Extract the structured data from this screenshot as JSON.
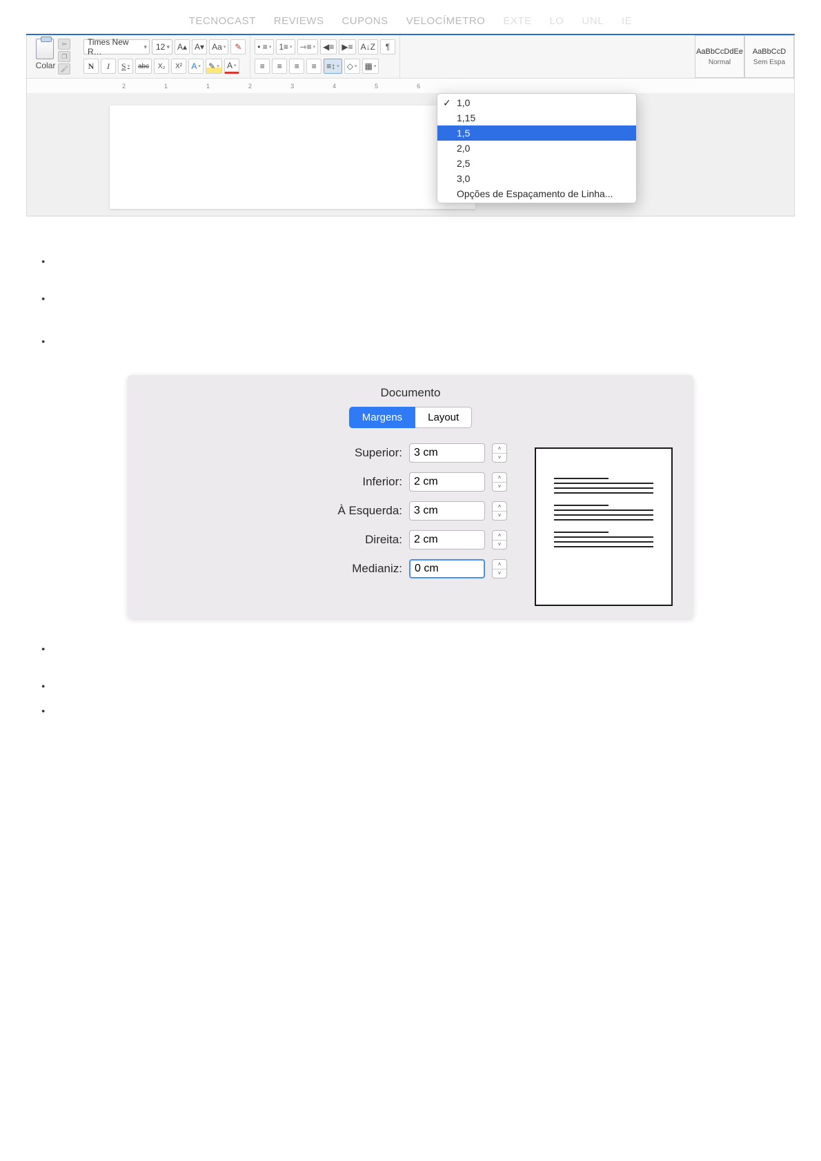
{
  "nav": {
    "items": [
      "TECNOCAST",
      "REVIEWS",
      "CUPONS",
      "VELOCÍMETRO",
      "EXTE",
      "LO",
      "UNL",
      "IE"
    ]
  },
  "ribbon": {
    "paste_label": "Colar",
    "font_name": "Times New R…",
    "font_size": "12",
    "bold": "N",
    "italic": "I",
    "underline": "S",
    "strike": "abc",
    "sub": "X₂",
    "sup": "X²",
    "grow": "A▴",
    "shrink": "A▾",
    "caps": "Aa",
    "clear": "✎",
    "texteffect": "A",
    "highlight": "✎",
    "fontcolor": "A",
    "left": "≡",
    "center": "≡",
    "right": "≡",
    "just": "≡",
    "bullets": "• ≡",
    "numbers": "1≡",
    "multilevel": "⇾≡",
    "outdent": "◀≡",
    "indent": "▶≡",
    "sort": "A↓Z",
    "pilcrow": "¶",
    "linespace": "≡↕",
    "fill": "◇",
    "border": "▦"
  },
  "styles": {
    "s1_prev": "AaBbCcDdEe",
    "s1_name": "Normal",
    "s2_prev": "AaBbCcD",
    "s2_name": "Sem Espa"
  },
  "linespacing": {
    "i0": "1,0",
    "i1": "1,15",
    "i2": "1,5",
    "i3": "2,0",
    "i4": "2,5",
    "i5": "3,0",
    "opts": "Opções de Espaçamento de Linha..."
  },
  "ruler": {
    "m0": "2",
    "m1": "1",
    "m2": "1",
    "m3": "2",
    "m4": "3",
    "m5": "4",
    "m6": "5",
    "m7": "6"
  },
  "dialog": {
    "title": "Documento",
    "tab_margins": "Margens",
    "tab_layout": "Layout",
    "lbl_top": "Superior:",
    "val_top": "3 cm",
    "lbl_bot": "Inferior:",
    "val_bot": "2 cm",
    "lbl_left": "À Esquerda:",
    "val_left": "3 cm",
    "lbl_right": "Direita:",
    "val_right": "2 cm",
    "lbl_gut": "Medianiz:",
    "val_gut": "0 cm"
  }
}
